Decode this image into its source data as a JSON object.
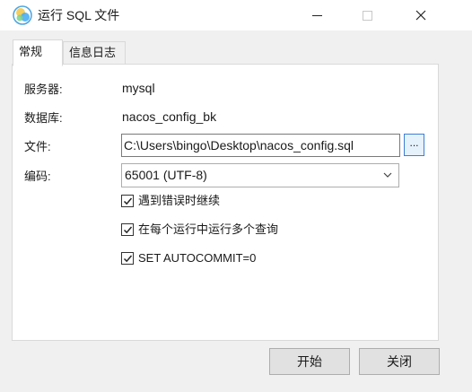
{
  "window": {
    "title": "运行 SQL 文件",
    "app_icon": "navicat-icon"
  },
  "tabs": [
    {
      "label": "常规",
      "active": true
    },
    {
      "label": "信息日志",
      "active": false
    }
  ],
  "form": {
    "server_label": "服务器:",
    "server_value": "mysql",
    "database_label": "数据库:",
    "database_value": "nacos_config_bk",
    "file_label": "文件:",
    "file_value": "C:\\Users\\bingo\\Desktop\\nacos_config.sql",
    "browse_label": "...",
    "encoding_label": "编码:",
    "encoding_value": "65001 (UTF-8)"
  },
  "options": [
    {
      "label": "遇到错误时继续",
      "checked": true
    },
    {
      "label": "在每个运行中运行多个查询",
      "checked": true
    },
    {
      "label": "SET AUTOCOMMIT=0",
      "checked": true
    }
  ],
  "buttons": {
    "start_label": "开始",
    "close_label": "关闭"
  },
  "colors": {
    "accent": "#3c7fd6",
    "panel": "#ffffff",
    "window": "#f0f0f0"
  }
}
